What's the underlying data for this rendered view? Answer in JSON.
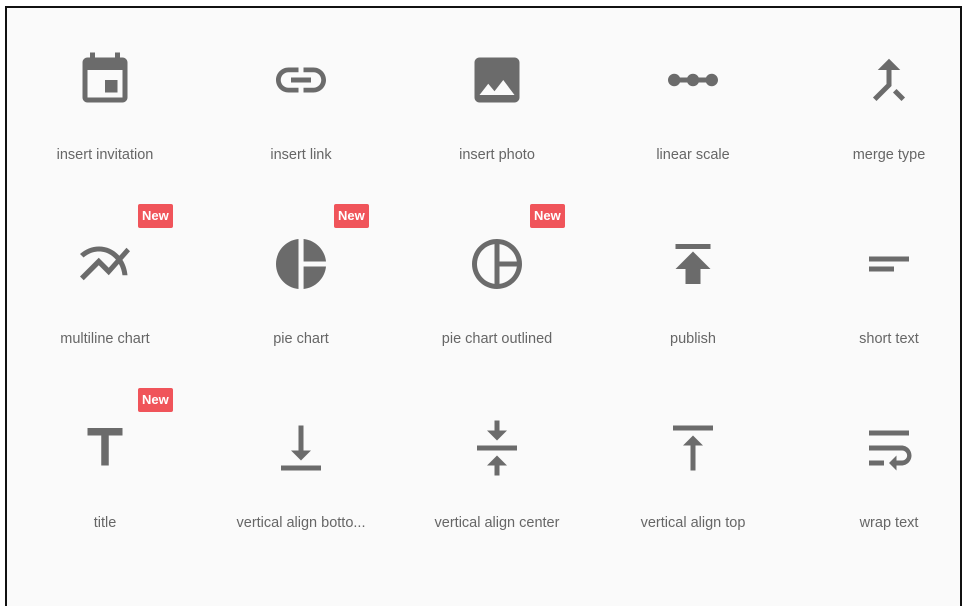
{
  "icons": [
    {
      "label": "insert invitation",
      "icon": "insert-invitation-icon",
      "badge": ""
    },
    {
      "label": "insert link",
      "icon": "insert-link-icon",
      "badge": ""
    },
    {
      "label": "insert photo",
      "icon": "insert-photo-icon",
      "badge": ""
    },
    {
      "label": "linear scale",
      "icon": "linear-scale-icon",
      "badge": ""
    },
    {
      "label": "merge type",
      "icon": "merge-type-icon",
      "badge": ""
    },
    {
      "label": "multiline chart",
      "icon": "multiline-chart-icon",
      "badge": "New"
    },
    {
      "label": "pie chart",
      "icon": "pie-chart-icon",
      "badge": "New"
    },
    {
      "label": "pie chart outlined",
      "icon": "pie-chart-outlined-icon",
      "badge": "New"
    },
    {
      "label": "publish",
      "icon": "publish-icon",
      "badge": ""
    },
    {
      "label": "short text",
      "icon": "short-text-icon",
      "badge": ""
    },
    {
      "label": "title",
      "icon": "title-icon",
      "badge": "New"
    },
    {
      "label": "vertical align botto...",
      "icon": "vertical-align-bottom-icon",
      "badge": ""
    },
    {
      "label": "vertical align center",
      "icon": "vertical-align-center-icon",
      "badge": ""
    },
    {
      "label": "vertical align top",
      "icon": "vertical-align-top-icon",
      "badge": ""
    },
    {
      "label": "wrap text",
      "icon": "wrap-text-icon",
      "badge": ""
    }
  ],
  "colors": {
    "icon": "#6b6b6b",
    "label": "#666666",
    "badge": "#f0545a",
    "background": "#fafafa"
  }
}
